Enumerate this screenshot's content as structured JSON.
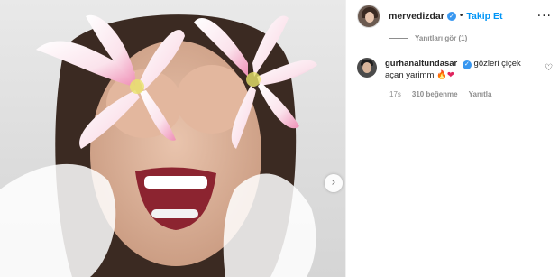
{
  "post": {
    "author": "mervedizdar",
    "follow_label": "Takip Et",
    "more_icon": "more-options-icon",
    "next_icon": "chevron-right-icon",
    "next_glyph": "›"
  },
  "replies": {
    "label": "Yanıtları gör (1)"
  },
  "comment": {
    "username": "gurhanaltundasar",
    "text": "gözleri çiçek açan yarimm",
    "emoji_fire": "🔥",
    "emoji_heart": "❤",
    "time": "17s",
    "likes": "310 beğenme",
    "reply_label": "Yanıtla",
    "like_icon": "heart-outline-icon"
  },
  "colors": {
    "accent": "#0095f6",
    "verified": "#3897f0",
    "muted": "#8e8e8e",
    "text": "#262626",
    "lily_pink": "#e45b93"
  }
}
